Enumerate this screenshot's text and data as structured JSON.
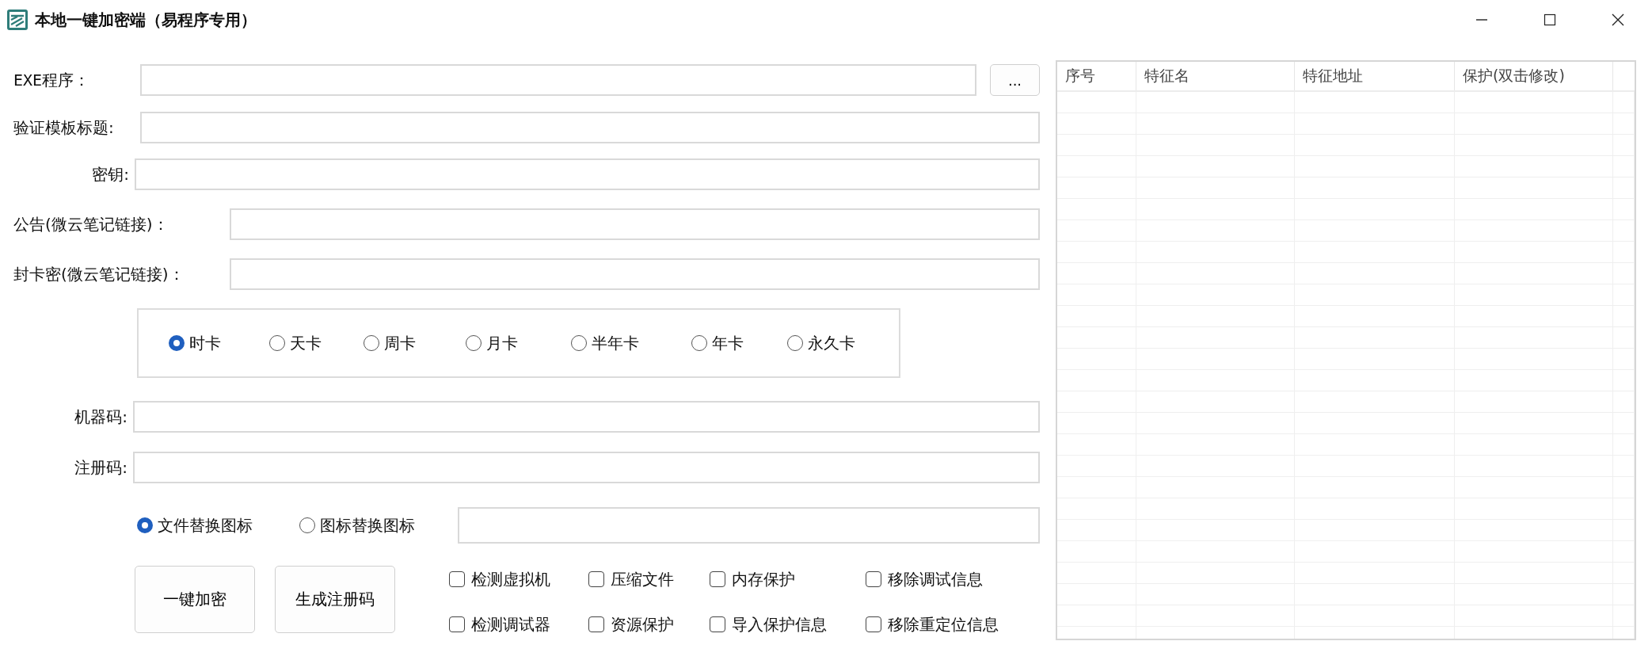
{
  "window": {
    "title": "本地一键加密端（易程序专用）"
  },
  "fields": [
    {
      "kind": "file",
      "label": "EXE程序：",
      "browse": "..."
    },
    {
      "kind": "wide",
      "label": "验证模板标题:"
    },
    {
      "kind": "right",
      "label": "密钥:"
    },
    {
      "kind": "long",
      "label": "公告(微云笔记链接)："
    },
    {
      "kind": "long",
      "label": "封卡密(微云笔记链接)："
    }
  ],
  "card_types": [
    {
      "label": "时卡",
      "selected": true
    },
    {
      "label": "天卡",
      "selected": false
    },
    {
      "label": "周卡",
      "selected": false
    },
    {
      "label": "月卡",
      "selected": false
    },
    {
      "label": "半年卡",
      "selected": false
    },
    {
      "label": "年卡",
      "selected": false
    },
    {
      "label": "永久卡",
      "selected": false
    }
  ],
  "codes": [
    {
      "label": "机器码:"
    },
    {
      "label": "注册码:"
    }
  ],
  "icon_modes": [
    {
      "label": "文件替换图标",
      "selected": true
    },
    {
      "label": "图标替换图标",
      "selected": false
    }
  ],
  "buttons": [
    "一键加密",
    "生成注册码"
  ],
  "options": [
    {
      "label": "检测虚拟机",
      "checked": false
    },
    {
      "label": "压缩文件",
      "checked": false
    },
    {
      "label": "内存保护",
      "checked": false
    },
    {
      "label": "移除调试信息",
      "checked": false
    },
    {
      "label": "检测调试器",
      "checked": false
    },
    {
      "label": "资源保护",
      "checked": false
    },
    {
      "label": "导入保护信息",
      "checked": false
    },
    {
      "label": "移除重定位信息",
      "checked": false
    }
  ],
  "table": {
    "columns": [
      "序号",
      "特征名",
      "特征地址",
      "保护(双击修改)"
    ]
  }
}
